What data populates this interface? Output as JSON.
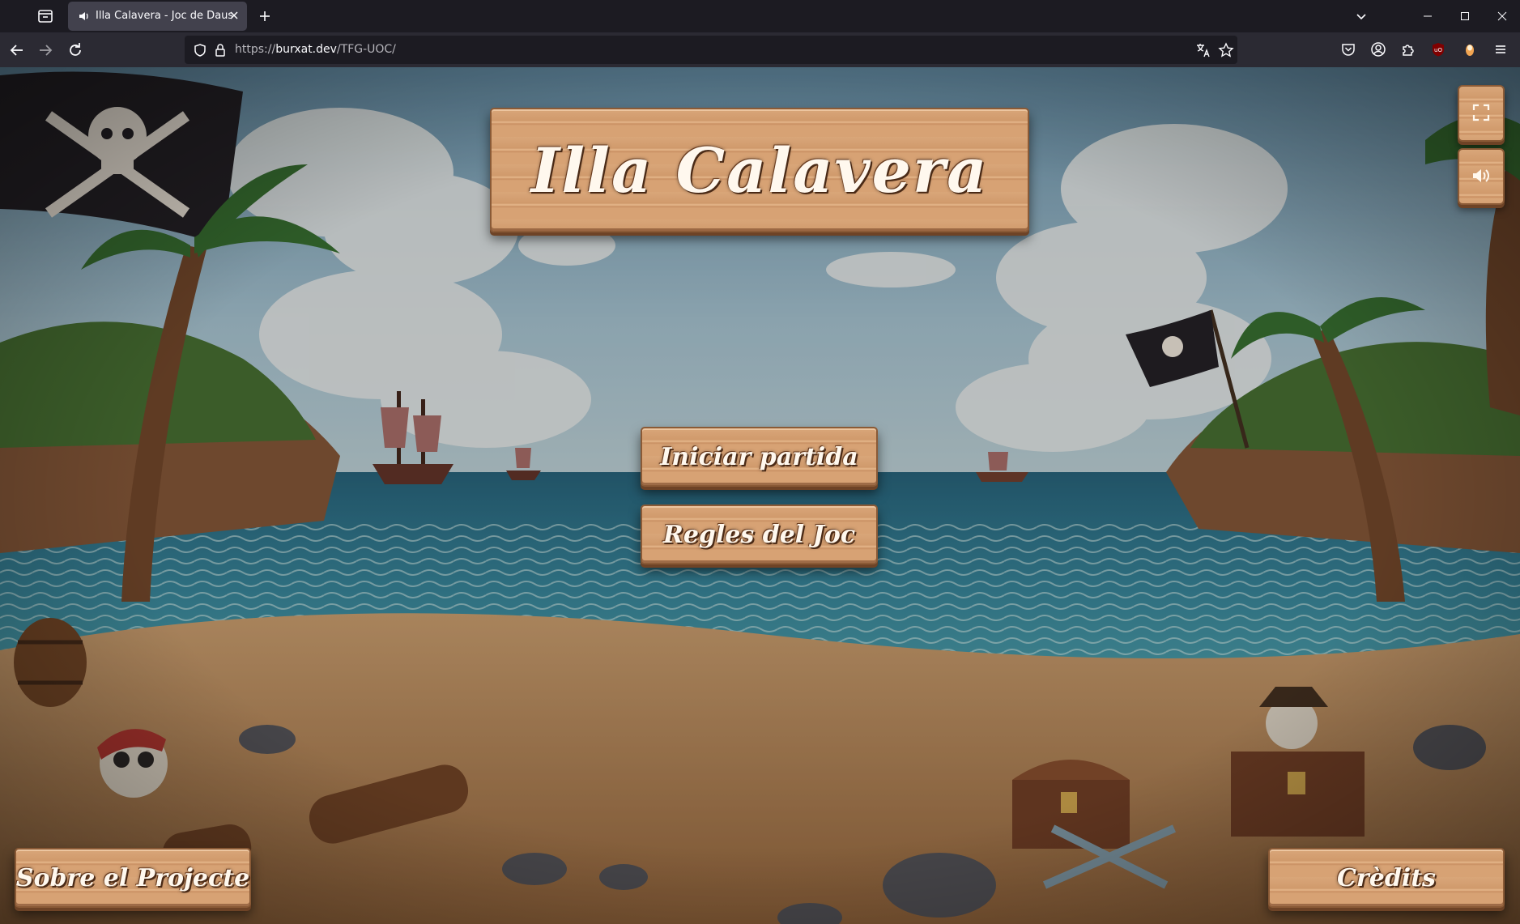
{
  "browser": {
    "tab": {
      "title": "Illa Calavera - Joc de Daus"
    },
    "url": {
      "prefix": "https://",
      "host": "burxat.dev",
      "path": "/TFG-UOC/"
    }
  },
  "game": {
    "title": "Illa Calavera",
    "buttons": {
      "start": "Iniciar partida",
      "rules": "Regles del Joc",
      "about": "Sobre el Projecte",
      "credits": "Crèdits"
    },
    "icons": {
      "fullscreen": "fullscreen-icon",
      "sound": "speaker-icon"
    }
  },
  "colors": {
    "plank": "#d9a679",
    "plank_border": "#8a5a36",
    "plank_text": "#fff8ee",
    "sky": "#8fb5c9",
    "sea": "#2f7f95",
    "sand": "#b98a5a"
  }
}
